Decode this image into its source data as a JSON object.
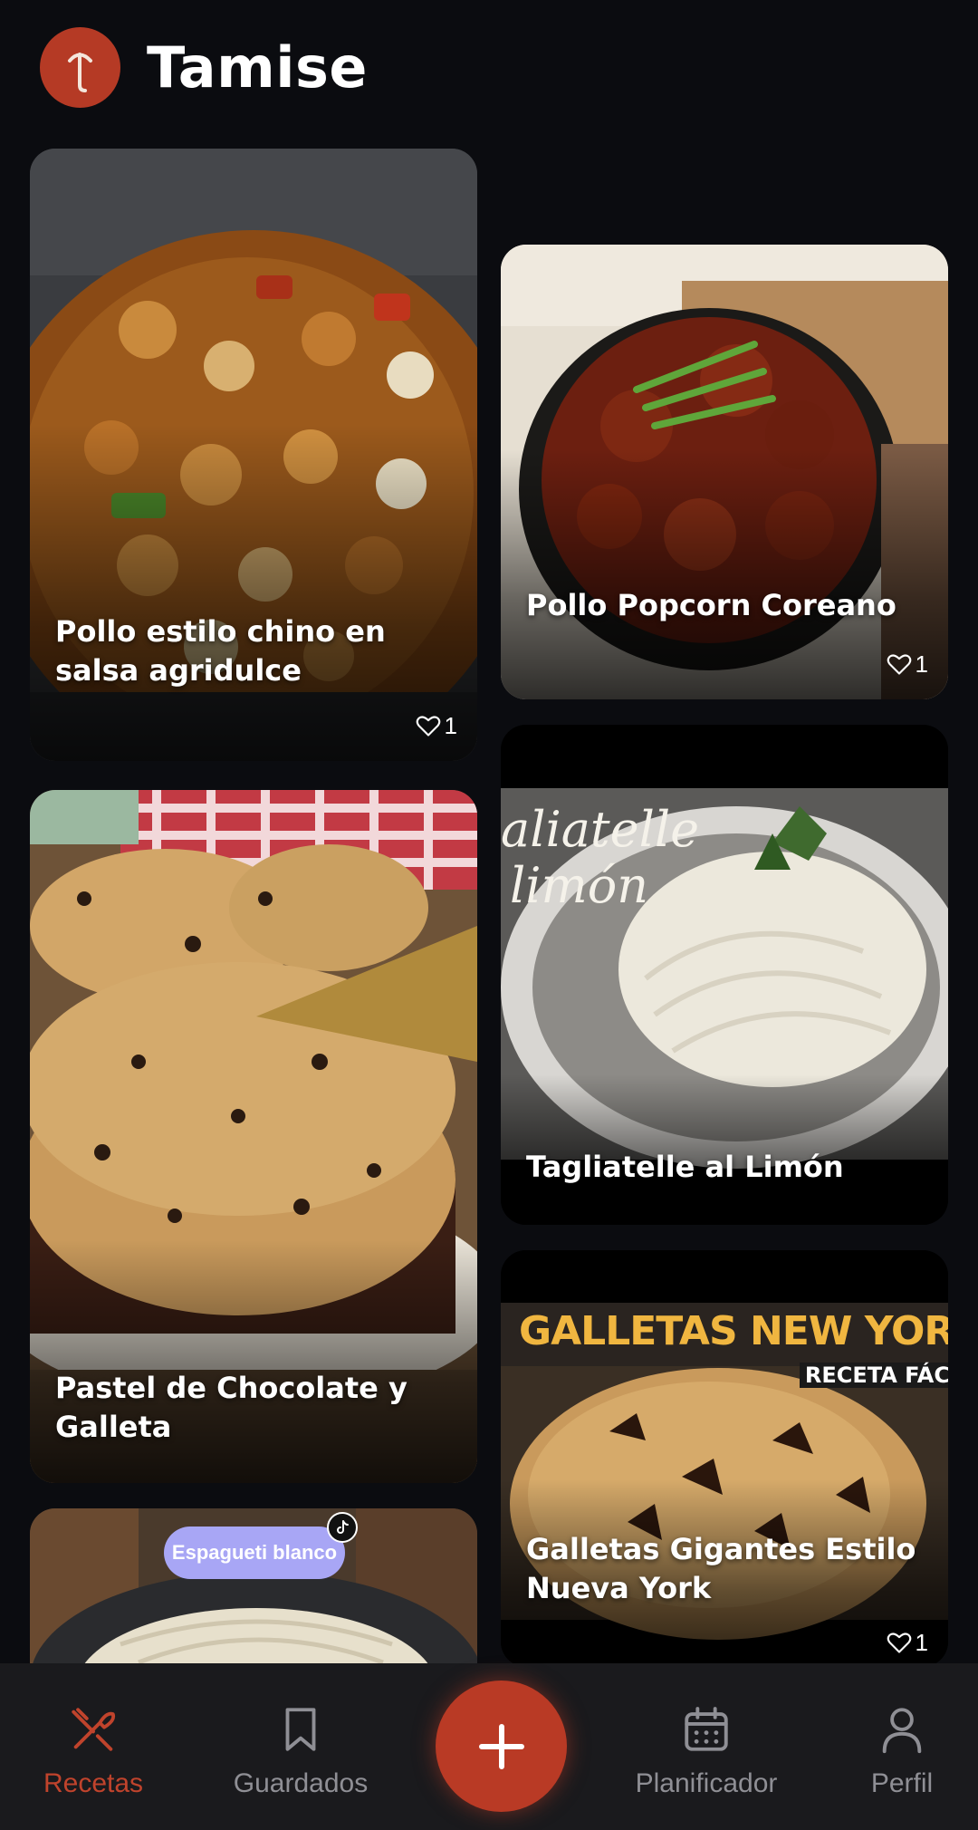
{
  "app": {
    "title": "Tamise",
    "logo_icon": "fork-logo-icon",
    "accent_color": "#b93a25"
  },
  "recipes": [
    {
      "title": "Pollo estilo chino en salsa agridulce",
      "likes": "1"
    },
    {
      "title": "Pollo Popcorn Coreano",
      "likes": "1"
    },
    {
      "title": "Tagliatelle al Limón"
    },
    {
      "title": "Pastel de Chocolate y Galleta"
    },
    {
      "title": "Galletas Gigantes Estilo Nueva York",
      "likes": "1",
      "thumbnail_text": "GALLETAS NEW YOR",
      "thumbnail_subtext": "RECETA FÁC"
    },
    {
      "badge": "Espagueti blanco"
    }
  ],
  "thumbnail_text": {
    "tagliatelle_overlay_line1": "aliatelle",
    "tagliatelle_overlay_line2": "limón"
  },
  "bottom_nav": {
    "items": [
      {
        "label": "Recetas",
        "icon": "utensils-crossed-icon",
        "active": true
      },
      {
        "label": "Guardados",
        "icon": "bookmark-icon",
        "active": false
      },
      {
        "label": "Planificador",
        "icon": "calendar-icon",
        "active": false
      },
      {
        "label": "Perfil",
        "icon": "user-icon",
        "active": false
      }
    ],
    "add_button_icon": "plus-icon"
  }
}
